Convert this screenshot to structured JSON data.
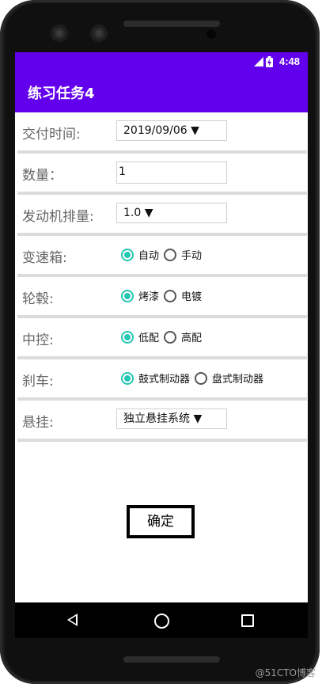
{
  "status_bar": {
    "time": "4:48"
  },
  "app_bar": {
    "title": "练习任务4"
  },
  "form": {
    "delivery_time": {
      "label": "交付时间:",
      "value": "2019/09/06 ▼"
    },
    "quantity": {
      "label": "数量：",
      "value": "1"
    },
    "engine": {
      "label": "发动机排量:",
      "value": "1.0 ▼"
    },
    "gearbox": {
      "label": "变速箱:",
      "options": [
        "自动",
        "手动"
      ],
      "selected": "自动"
    },
    "hub": {
      "label": "轮毂:",
      "options": [
        "烤漆",
        "电镀"
      ],
      "selected": "烤漆"
    },
    "console": {
      "label": "中控:",
      "options": [
        "低配",
        "高配"
      ],
      "selected": "低配"
    },
    "brake": {
      "label": "刹车:",
      "options": [
        "鼓式制动器",
        "盘式制动器"
      ],
      "selected": "鼓式制动器"
    },
    "suspension": {
      "label": "悬挂:",
      "value": "独立悬挂系统 ▼"
    }
  },
  "confirm_button": {
    "label": "确定"
  },
  "watermark": "@51CTO博客",
  "colors": {
    "accent": "#6200ee",
    "radio": "#26c6b4"
  }
}
